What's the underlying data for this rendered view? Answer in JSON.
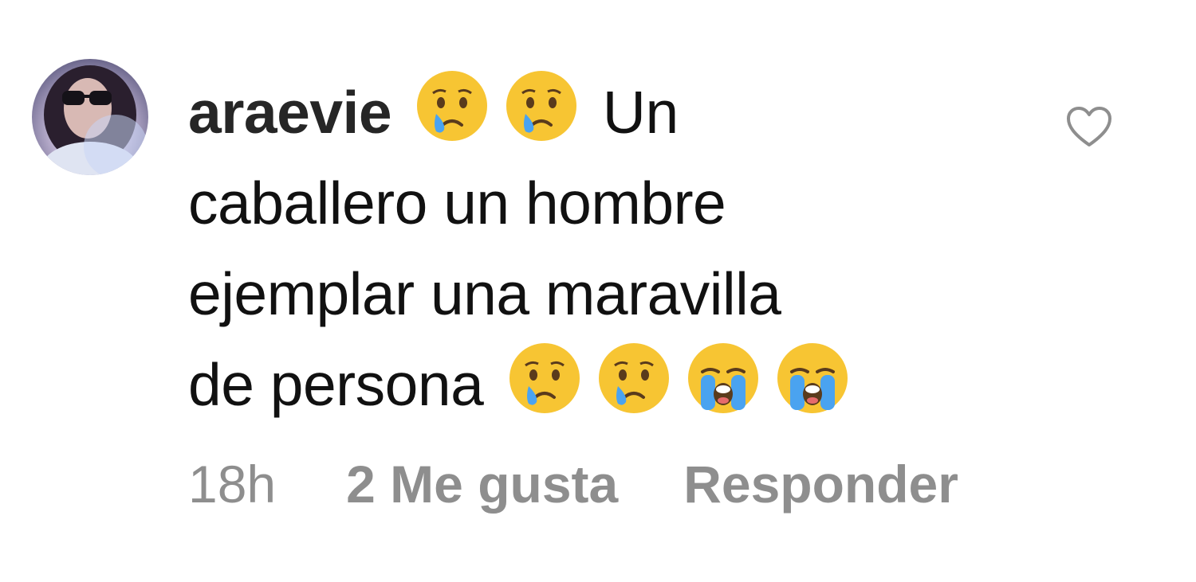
{
  "comment": {
    "username": "araevie",
    "text_line1": "Un",
    "text_line2": "caballero un hombre",
    "text_line3": "ejemplar una maravilla",
    "text_line4": "de persona",
    "emojis_after_username": [
      "crying-face-emoji",
      "crying-face-emoji"
    ],
    "emojis_after_text": [
      "crying-face-emoji",
      "crying-face-emoji",
      "loudly-crying-face-emoji",
      "loudly-crying-face-emoji"
    ]
  },
  "meta": {
    "time": "18h",
    "likes": "2 Me gusta",
    "reply": "Responder"
  },
  "icons": {
    "like": "heart-outline-icon",
    "avatar": "user-avatar"
  },
  "colors": {
    "text": "#111111",
    "meta": "#8e8e8e",
    "heart": "#8e8e8e"
  }
}
